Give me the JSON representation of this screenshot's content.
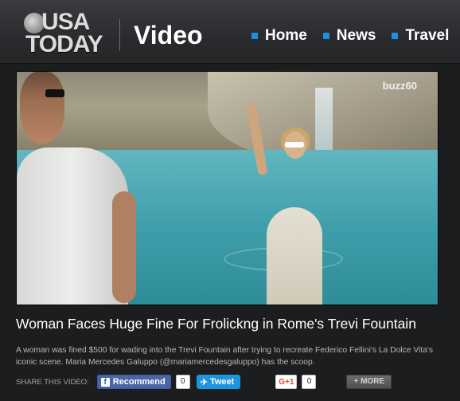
{
  "header": {
    "logo_line1": "USA",
    "logo_line2": "TODAY",
    "section": "Video",
    "nav": [
      {
        "label": "Home"
      },
      {
        "label": "News"
      },
      {
        "label": "Travel"
      }
    ]
  },
  "video": {
    "watermark": "buzz60"
  },
  "article": {
    "title": "Woman Faces Huge Fine For Frolickng in Rome's Trevi Fountain",
    "description": "A woman was fined $500 for wading into the Trevi Fountain after trying to recreate Federico Fellini's La Dolce Vita's iconic scene. Maria Mercedes Galuppo (@mariamercedesgaluppo) has the scoop."
  },
  "share": {
    "label": "SHARE THIS VIDEO:",
    "facebook_icon": "f",
    "facebook_label": "Recommend",
    "facebook_count": "0",
    "twitter_icon": "bird-icon",
    "twitter_label": "Tweet",
    "google_label": "G+1",
    "google_count": "0",
    "more_label": "+ MORE"
  },
  "colors": {
    "nav_bullet": "#1e8fe0",
    "facebook": "#4a66a6",
    "twitter": "#1b95e0"
  }
}
